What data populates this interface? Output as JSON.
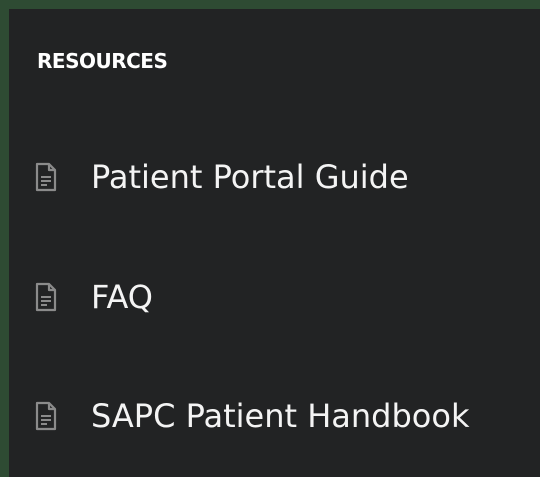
{
  "resources": {
    "heading": "RESOURCES",
    "items": [
      {
        "label": "Patient Portal Guide",
        "icon": "document-icon"
      },
      {
        "label": "FAQ",
        "icon": "document-icon"
      },
      {
        "label": "SAPC Patient Handbook",
        "icon": "document-icon"
      }
    ]
  },
  "colors": {
    "frame": "#2e4b33",
    "panel_background": "#222324",
    "text": "#f4f4f4",
    "icon": "#8b8b8b"
  }
}
